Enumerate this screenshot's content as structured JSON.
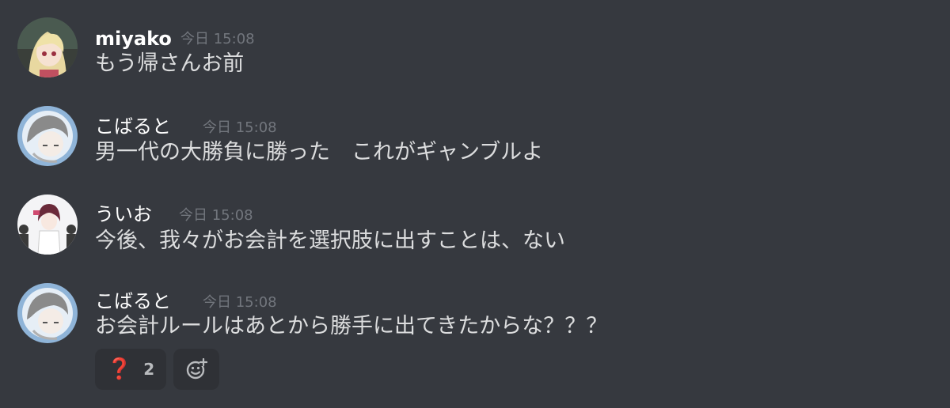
{
  "messages": [
    {
      "username": "miyako",
      "timestamp": "今日 15:08",
      "content": "もう帰さんお前",
      "avatar": "miyako-avatar"
    },
    {
      "username": "こばると",
      "timestamp": "今日 15:08",
      "content": "男一代の大勝負に勝った　これがギャンブルよ",
      "avatar": "kobaruto-avatar"
    },
    {
      "username": "ういお",
      "timestamp": "今日 15:08",
      "content": "今後、我々がお会計を選択肢に出すことは、ない",
      "avatar": "uio-avatar"
    },
    {
      "username": "こばると",
      "timestamp": "今日 15:08",
      "content": "お会計ルールはあとから勝手に出てきたからな？？？",
      "avatar": "kobaruto-avatar"
    }
  ],
  "reactions": [
    {
      "emoji": "❓",
      "count": "2",
      "icon": "red-question-mark-icon"
    }
  ],
  "add_reaction_icon": "add-reaction-icon",
  "colors": {
    "background": "#36393f",
    "username": "#ffffff",
    "timestamp": "#72767d",
    "message_text": "#dcddde",
    "reaction_background": "#2f3136",
    "reaction_count": "#b9bbbe",
    "question_mark": "#dd2e44"
  }
}
